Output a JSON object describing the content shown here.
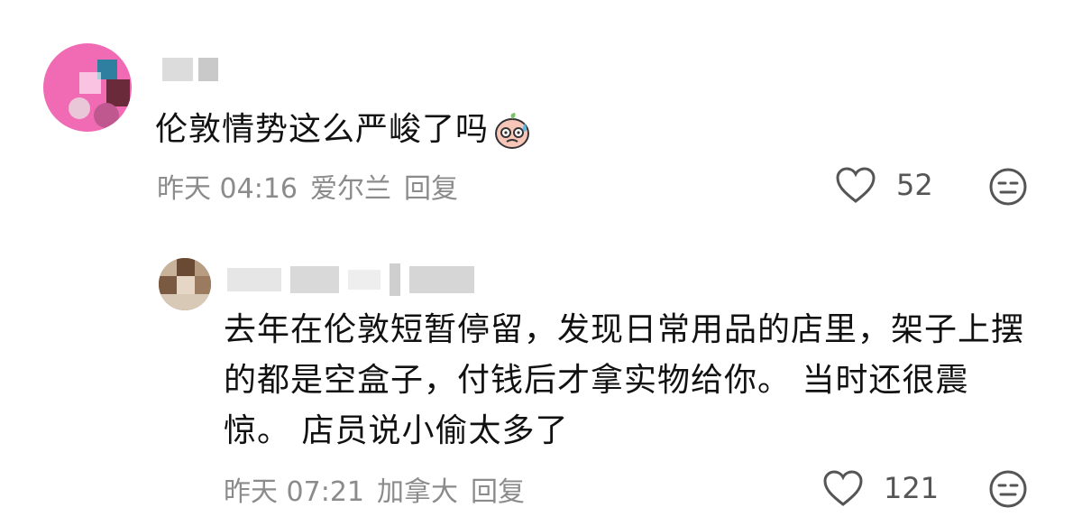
{
  "comments": [
    {
      "text": "伦敦情势这么严峻了吗",
      "emoji": "sweat-face-emoji",
      "time": "昨天 04:16",
      "location": "爱尔兰",
      "reply_label": "回复",
      "likes": "52"
    },
    {
      "text": "去年在伦敦短暂停留，发现日常用品的店里，架子上摆的都是空盒子，付钱后才拿实物给你。 当时还很震惊。 店员说小偷太多了",
      "time": "昨天 07:21",
      "location": "加拿大",
      "reply_label": "回复",
      "likes": "121"
    }
  ],
  "icons": {
    "like": "heart-outline-icon",
    "dislike": "neutral-face-icon"
  },
  "colors": {
    "meta": "#8b8b8b",
    "avatar1": "#f06ab4",
    "avatar2": "#8a6e55"
  }
}
